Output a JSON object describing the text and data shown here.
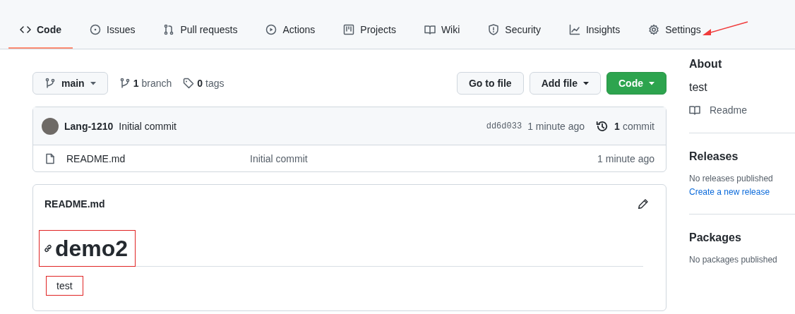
{
  "tabs": [
    {
      "label": "Code",
      "selected": true,
      "pointed": false
    },
    {
      "label": "Issues",
      "selected": false,
      "pointed": false
    },
    {
      "label": "Pull requests",
      "selected": false,
      "pointed": false
    },
    {
      "label": "Actions",
      "selected": false,
      "pointed": false
    },
    {
      "label": "Projects",
      "selected": false,
      "pointed": false
    },
    {
      "label": "Wiki",
      "selected": false,
      "pointed": false
    },
    {
      "label": "Security",
      "selected": false,
      "pointed": false
    },
    {
      "label": "Insights",
      "selected": false,
      "pointed": false
    },
    {
      "label": "Settings",
      "selected": false,
      "pointed": true
    }
  ],
  "toolbar": {
    "branch_button": "main",
    "branches": {
      "count": "1",
      "label": "branch"
    },
    "tags": {
      "count": "0",
      "label": "tags"
    },
    "buttons": [
      {
        "label": "Go to file",
        "kind": "plain"
      },
      {
        "label": "Add file",
        "kind": "dropdown"
      },
      {
        "label": "Code",
        "kind": "primary"
      }
    ]
  },
  "latest_commit": {
    "author": "Lang-1210",
    "message": "Initial commit",
    "sha": "dd6d033",
    "time": "1 minute ago",
    "commit_count": "1",
    "commit_label": "commit"
  },
  "files": [
    {
      "name": "README.md",
      "message": "Initial commit",
      "time": "1 minute ago"
    }
  ],
  "readme": {
    "title": "README.md",
    "heading": {
      "text": "demo2",
      "highlighted": true
    },
    "paragraph": {
      "text": "test",
      "highlighted": true
    }
  },
  "sidebar": {
    "about": {
      "title": "About",
      "description": "test",
      "links": [
        "Readme"
      ]
    },
    "releases": {
      "title": "Releases",
      "note": "No releases published",
      "link": "Create a new release"
    },
    "packages": {
      "title": "Packages",
      "note": "No packages published"
    }
  }
}
